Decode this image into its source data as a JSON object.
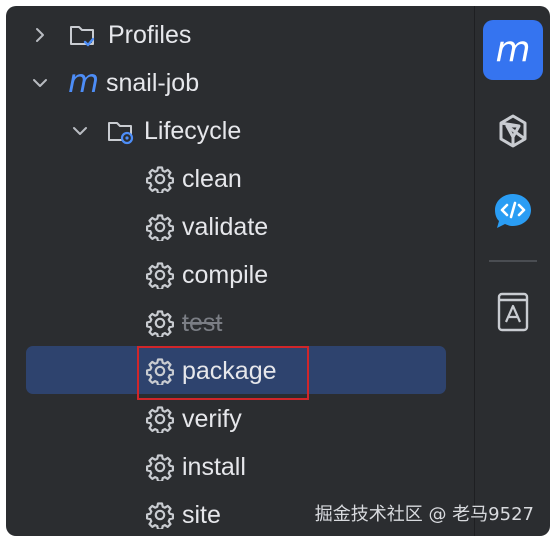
{
  "tree": {
    "profiles_label": "Profiles",
    "project_label": "snail-job",
    "project_icon_letter": "m",
    "lifecycle_label": "Lifecycle",
    "phases": [
      {
        "label": "clean",
        "selected": false,
        "disabled": false
      },
      {
        "label": "validate",
        "selected": false,
        "disabled": false
      },
      {
        "label": "compile",
        "selected": false,
        "disabled": false
      },
      {
        "label": "test",
        "selected": false,
        "disabled": true
      },
      {
        "label": "package",
        "selected": true,
        "disabled": false
      },
      {
        "label": "verify",
        "selected": false,
        "disabled": false
      },
      {
        "label": "install",
        "selected": false,
        "disabled": false
      },
      {
        "label": "site",
        "selected": false,
        "disabled": false
      }
    ]
  },
  "sidebar": {
    "maven_letter": "m",
    "tools": [
      "maven-icon",
      "ai-assistant-icon",
      "code-chat-icon",
      "book-icon"
    ]
  },
  "watermark": "掘金技术社区 @ 老马9527",
  "colors": {
    "background": "#2b2d30",
    "selection": "#2e436e",
    "highlight_box": "#d0262a",
    "maven_blue": "#3574f0"
  }
}
